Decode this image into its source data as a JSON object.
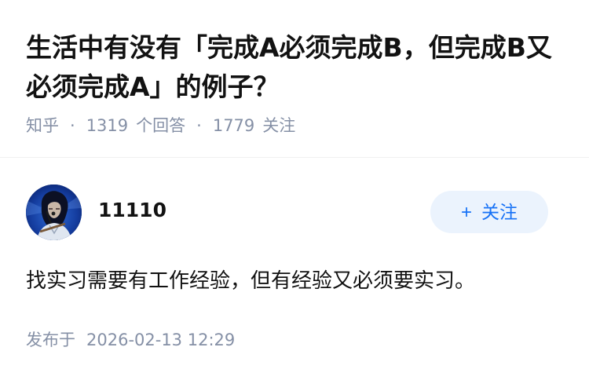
{
  "question": {
    "title": "生活中有没有「完成A必须完成B，但完成B又必须完成A」的例子？",
    "source": "知乎",
    "separator": "·",
    "answer_count": "1319",
    "answer_label": "个回答",
    "follower_count": "1779",
    "follower_label": "关注"
  },
  "answer": {
    "author": {
      "name": "11110",
      "avatar_icon": "user-avatar-photo"
    },
    "follow_button": {
      "icon": "plus-icon",
      "icon_glyph": "+",
      "label": "关注"
    },
    "content": "找实习需要有工作经验，但有经验又必须要实习。",
    "publish_label": "发布于",
    "publish_time": "2026-02-13 12:29"
  },
  "colors": {
    "meta_gray": "#8590a6",
    "accent_blue": "#1772f6",
    "follow_bg": "#ebf3fd",
    "text": "#121212"
  }
}
